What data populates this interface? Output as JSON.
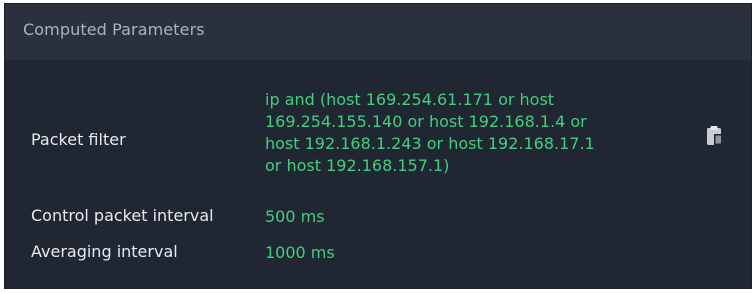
{
  "panel": {
    "title": "Computed Parameters"
  },
  "params": {
    "packet_filter": {
      "label": "Packet filter",
      "value_lines": [
        "ip and (host 169.254.61.171 or host",
        "169.254.155.140 or host 192.168.1.4 or",
        "host 192.168.1.243 or host 192.168.17.1",
        "or host 192.168.157.1)"
      ],
      "copy_icon": "clipboard-icon"
    },
    "control_packet_interval": {
      "label": "Control packet interval",
      "value": "500 ms"
    },
    "averaging_interval": {
      "label": "Averaging interval",
      "value": "1000 ms"
    }
  },
  "colors": {
    "panel_bg": "#202732",
    "header_bg": "#2a313c",
    "header_text": "#aab2be",
    "label_text": "#e7ebf0",
    "value_text": "#3fd07e"
  }
}
